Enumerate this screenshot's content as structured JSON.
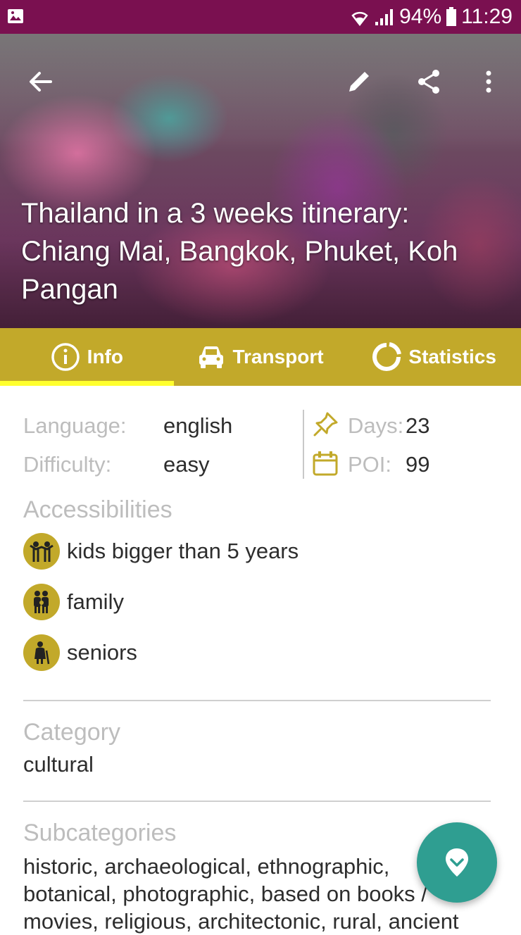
{
  "status_bar": {
    "battery": "94%",
    "time": "11:29"
  },
  "hero": {
    "title": "Thailand in a 3 weeks itinerary: Chiang Mai, Bangkok, Phuket, Koh Pangan"
  },
  "tabs": [
    {
      "label": "Info",
      "icon": "info-icon",
      "active": true
    },
    {
      "label": "Transport",
      "icon": "car-icon",
      "active": false
    },
    {
      "label": "Statistics",
      "icon": "donut-chart-icon",
      "active": false
    }
  ],
  "info": {
    "language_label": "Language:",
    "language_value": "english",
    "difficulty_label": "Difficulty:",
    "difficulty_value": "easy",
    "days_label": "Days:",
    "days_value": "23",
    "poi_label": "POI:",
    "poi_value": "99"
  },
  "accessibilities": {
    "title": "Accessibilities",
    "items": [
      {
        "label": "kids bigger than 5 years",
        "icon": "kids-icon"
      },
      {
        "label": "family",
        "icon": "family-icon"
      },
      {
        "label": "seniors",
        "icon": "senior-icon"
      }
    ]
  },
  "category": {
    "title": "Category",
    "value": "cultural"
  },
  "subcategories": {
    "title": "Subcategories",
    "line1": "historic, archaeological, ethnographic,",
    "line2": "botanical, photographic, based on books /",
    "line3": "movies, religious, architectonic, rural, ancient"
  },
  "colors": {
    "status_bar": "#7a1050",
    "accent": "#c2a92a",
    "tab_indicator": "#ffff2e",
    "fab": "#2f9e91"
  }
}
